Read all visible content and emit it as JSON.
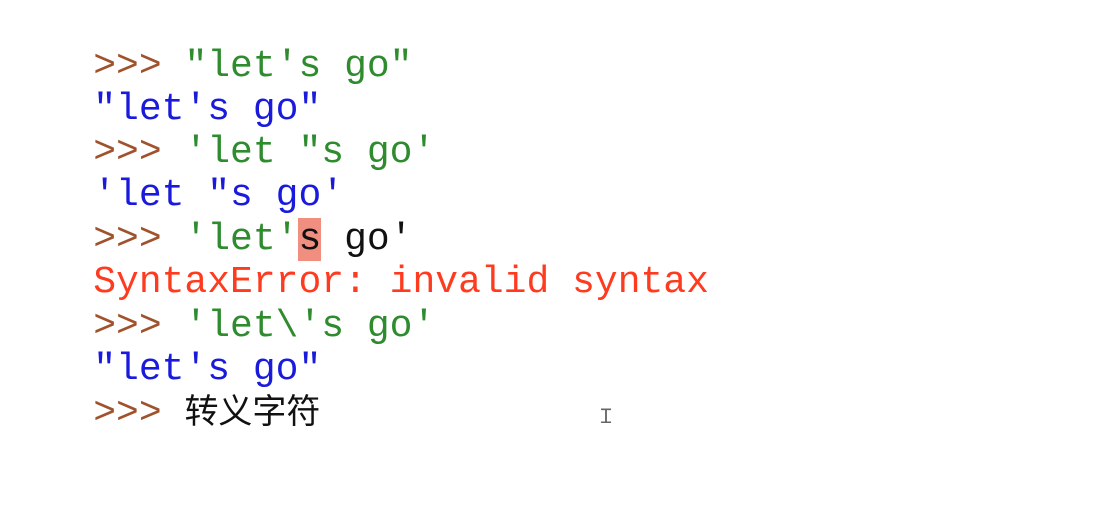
{
  "shell": {
    "lines": [
      {
        "prompt": ">>> ",
        "text": "\"let's go\""
      },
      {
        "output": "\"let's go\""
      },
      {
        "prompt": ">>> ",
        "text": "'let \"s go'"
      },
      {
        "output": "'let \"s go'"
      },
      {
        "prompt": ">>> ",
        "text_before": "'let'",
        "highlight": "s",
        "text_after": " go'"
      },
      {
        "error": "SyntaxError: invalid syntax"
      },
      {
        "prompt": ">>> ",
        "text": "'let\\'s go'"
      },
      {
        "output": "\"let's go\""
      },
      {
        "prompt": ">>> ",
        "text": "转义字符"
      }
    ],
    "cursor_icon": "text-ibeam-icon"
  },
  "colors": {
    "prompt": "#a0522d",
    "input": "#2e8b2e",
    "output": "#1a1adc",
    "error": "#ff3b1f",
    "error_highlight": "#f08f80",
    "plain": "#111111"
  }
}
